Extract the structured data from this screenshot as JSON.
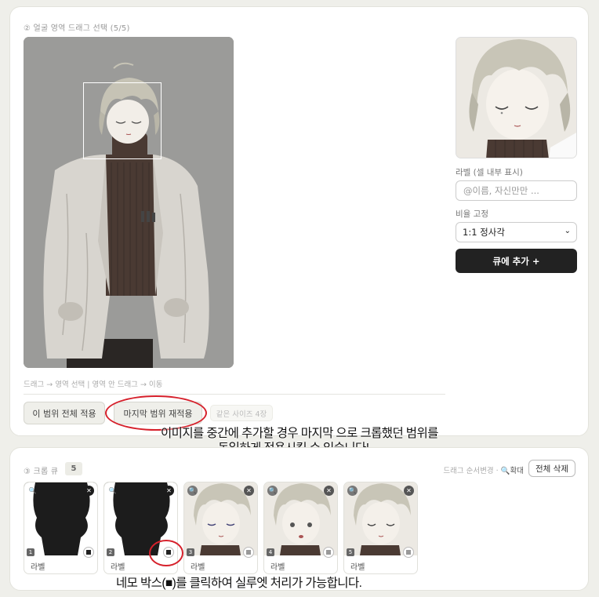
{
  "top_section": {
    "title": "② 얼굴 영역 드래그 선택 (5/5)",
    "hint": "드래그 → 영역 선택 | 영역 안 드래그 → 이동",
    "btn_apply_all": "이 범위 전체 적용",
    "btn_reapply_last": "마지막 범위 재적용",
    "btn_same_size": "같은 사이즈 4장"
  },
  "right_panel": {
    "label_title": "라벨 (셀 내부 표시)",
    "label_placeholder": "@이름, 자신만만 ...",
    "ratio_title": "비율 고정",
    "ratio_value": "1:1 정사각",
    "add_button": "큐에 추가 +"
  },
  "annotations": {
    "reapply_line1": "이미지를 중간에 추가할 경우 마지막 으로 크롭했던 범위를",
    "reapply_line2": "동일하게 적용시킬 수 있습니다!",
    "silhouette_note": "네모 박스(■)를 클릭하여 실루엣 처리가 가능합니다."
  },
  "queue": {
    "title": "③ 크롭 큐",
    "count": "5",
    "tools_text": "드래그 순서변경 ·",
    "zoom_text": "확대",
    "clear_button": "전체 삭제",
    "items": [
      {
        "num": "1",
        "label": "라벨",
        "silhouette": true
      },
      {
        "num": "2",
        "label": "라벨",
        "silhouette": true
      },
      {
        "num": "3",
        "label": "라벨",
        "silhouette": false
      },
      {
        "num": "4",
        "label": "라벨",
        "silhouette": false
      },
      {
        "num": "5",
        "label": "라벨",
        "silhouette": false
      }
    ]
  },
  "colors": {
    "accent_dark": "#222222",
    "annotation_red": "#d6202b",
    "page_bg": "#efefea"
  }
}
